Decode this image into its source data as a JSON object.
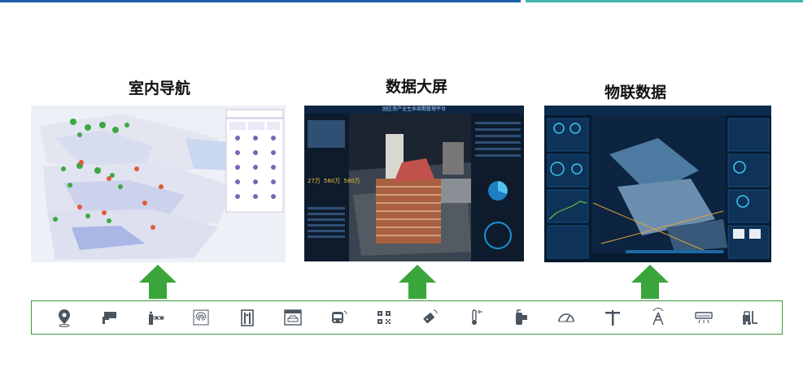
{
  "colors": {
    "accent_blue": "#1f5fa8",
    "accent_teal": "#3fb6b0",
    "arrow_green": "#3aa53a",
    "frame_green": "#3a9a3a",
    "icon_gray": "#4a5560"
  },
  "sections": [
    {
      "title": "室内导航"
    },
    {
      "title": "数据大屏"
    },
    {
      "title": "物联数据"
    }
  ],
  "dashboard": {
    "header": "园区资产全生命周期管理平台",
    "stats": [
      "27万",
      "580万",
      "580万"
    ]
  },
  "icons": [
    "location-pin-icon",
    "cctv-camera-icon",
    "barrier-gate-icon",
    "fingerprint-icon",
    "security-door-icon",
    "parking-garage-icon",
    "bus-icon",
    "qr-code-icon",
    "rfid-tag-icon",
    "thermometer-icon",
    "fire-extinguisher-icon",
    "speedometer-icon",
    "tower-crane-icon",
    "antenna-tower-icon",
    "air-conditioner-icon",
    "forklift-icon"
  ]
}
